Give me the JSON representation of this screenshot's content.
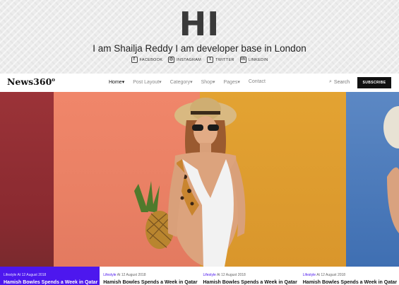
{
  "header": {
    "logo_text": "HI",
    "tagline": "I am Shailja Reddy I am developer base in London",
    "socials": [
      {
        "label": "FACEBOOK",
        "icon": "f"
      },
      {
        "label": "INSTAGRAM",
        "icon": "◎"
      },
      {
        "label": "TWITTER",
        "icon": "t"
      },
      {
        "label": "LINKEDIN",
        "icon": "in"
      }
    ]
  },
  "nav": {
    "brand": "News360",
    "brand_sup": "o",
    "items": [
      "Home",
      "Post Layout",
      "Category",
      "Shop",
      "Pages",
      "Contact"
    ],
    "chevron": "▾",
    "search_icon": "⌕",
    "search_label": "Search",
    "subscribe_label": "SUBSCRIBE"
  },
  "cards": [
    {
      "category": "Lifestyle",
      "date": "At 12 August 2018",
      "title": "Hamish Bowles Spends a Week in Qatar"
    },
    {
      "category": "Lifestyle",
      "date": "At 12 August 2018",
      "title": "Hamish Bowles Spends a Week in Qatar"
    },
    {
      "category": "Lifestyle",
      "date": "At 12 August 2018",
      "title": "Hamish Bowles Spends a Week in Qatar"
    },
    {
      "category": "Lifestyle",
      "date": "At 12 August 2018",
      "title": "Hamish Bowles Spends a Week in Qatar"
    }
  ],
  "colors": {
    "accent": "#4d17ee",
    "dark": "#111111"
  }
}
